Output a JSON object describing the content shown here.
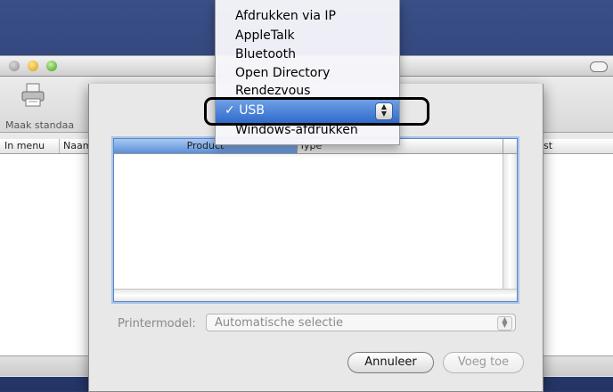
{
  "toolbar": {
    "make_default_label": "Maak standaa"
  },
  "printer_list": {
    "col_in_menu": "In menu",
    "col_name": "Naam",
    "col_status_tail": "st"
  },
  "sheet": {
    "table": {
      "col_product": "Product",
      "col_type": "Type"
    },
    "printer_model": {
      "label": "Printermodel:",
      "value": "Automatische selectie"
    },
    "buttons": {
      "cancel": "Annuleer",
      "add": "Voeg toe"
    }
  },
  "popup_menu": {
    "items": [
      "Afdrukken via IP",
      "AppleTalk",
      "Bluetooth",
      "Open Directory",
      "Rendezvous",
      "Windows-afdrukken"
    ],
    "selected": "USB",
    "checkmark": "✓"
  },
  "colors": {
    "selection": "#2f6bcb",
    "header_highlight": "#5b8fd6"
  }
}
